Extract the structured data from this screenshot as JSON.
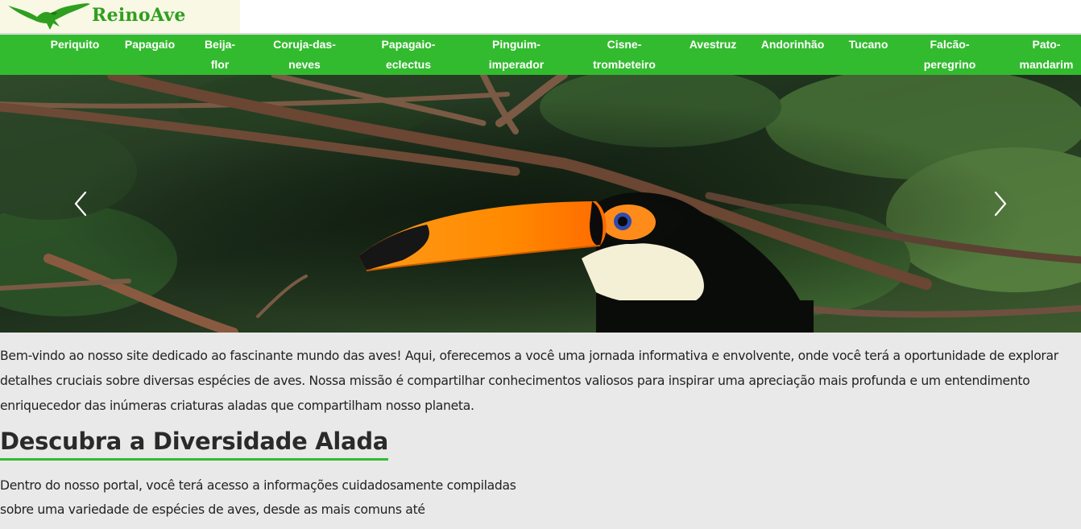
{
  "brand": {
    "name": "ReinoAve",
    "logo_icon": "eagle-icon",
    "accent_color": "#33bb2f",
    "logo_text_color": "#2e9f1f"
  },
  "nav": {
    "items": [
      {
        "label": "Periquito"
      },
      {
        "label": "Papagaio"
      },
      {
        "label": "Beija-\nflor"
      },
      {
        "label": "Coruja-das-\nneves"
      },
      {
        "label": "Papagaio-\neclectus"
      },
      {
        "label": "Pinguim-\nimperador"
      },
      {
        "label": "Cisne-\ntrombeteiro"
      },
      {
        "label": "Avestruz"
      },
      {
        "label": "Andorinhão"
      },
      {
        "label": "Tucano"
      },
      {
        "label": "Falcão-\nperegrino"
      },
      {
        "label": "Pato-\nmandarim"
      }
    ]
  },
  "carousel": {
    "prev_icon": "chevron-left-icon",
    "next_icon": "chevron-right-icon"
  },
  "main": {
    "intro": "Bem-vindo ao nosso site dedicado ao fascinante mundo das aves! Aqui, oferecemos a você uma jornada informativa e envolvente, onde você terá a oportunidade de explorar detalhes cruciais sobre diversas espécies de aves. Nossa missão é compartilhar conhecimentos valiosos para inspirar uma apreciação mais profunda e um entendimento enriquecedor das inúmeras criaturas aladas que compartilham nosso planeta.",
    "section_title": "Descubra a Diversidade Alada",
    "section_text": "Dentro do nosso portal, você terá acesso a informações cuidadosamente compiladas sobre uma variedade de espécies de aves, desde as mais comuns até"
  }
}
